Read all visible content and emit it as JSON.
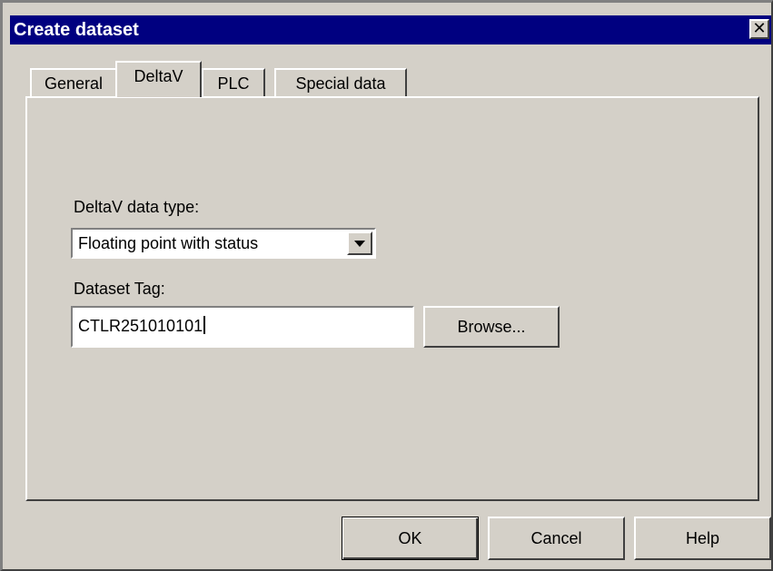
{
  "window": {
    "title": "Create dataset",
    "close_glyph": "✕"
  },
  "tabs": [
    {
      "label": "General",
      "active": false
    },
    {
      "label": "DeltaV",
      "active": true
    },
    {
      "label": "PLC",
      "active": false
    },
    {
      "label": "Special data",
      "active": false
    }
  ],
  "form": {
    "data_type_label": "DeltaV data type:",
    "data_type_value": "Floating point with status",
    "dataset_tag_label": "Dataset Tag:",
    "dataset_tag_value": "CTLR251010101",
    "browse_label": "Browse..."
  },
  "buttons": {
    "ok": "OK",
    "cancel": "Cancel",
    "help": "Help"
  },
  "icons": {
    "close": "close-icon",
    "dropdown": "chevron-down-icon"
  },
  "colors": {
    "titlebar": "#000080",
    "face": "#d4d0c8"
  }
}
